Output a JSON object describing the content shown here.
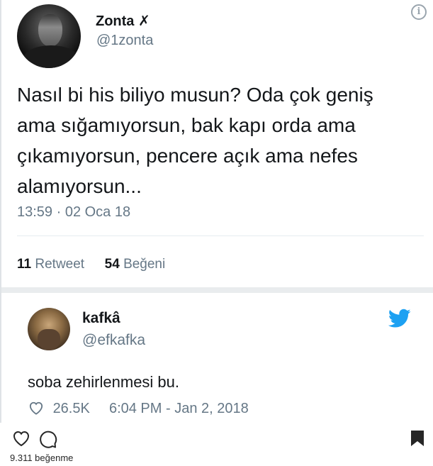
{
  "tweet1": {
    "display_name": "Zonta",
    "name_mark": "✗",
    "handle": "@1zonta",
    "text": "Nasıl bi his biliyo musun? Oda çok geniş ama sığamıyorsun, bak kapı orda ama çıkamıyorsun, pencere açık ama nefes alamıyorsun...",
    "timestamp": "13:59 · 02 Oca 18",
    "retweet_count": "11",
    "retweet_label": "Retweet",
    "like_count": "54",
    "like_label": "Beğeni",
    "info_icon": "info-icon"
  },
  "tweet2": {
    "display_name": "kafkâ",
    "handle": "@efkafka",
    "text": "soba zehirlenmesi bu.",
    "like_count": "26.5K",
    "timestamp": "6:04 PM - Jan 2, 2018",
    "icons": [
      "twitter-bird-icon",
      "heart-outline-icon"
    ]
  },
  "instagram": {
    "likes_text": "9.311 beğenme",
    "icons": [
      "heart-icon",
      "comment-icon",
      "bookmark-icon"
    ]
  },
  "colors": {
    "twitter_blue": "#1da1f2",
    "muted_text": "#657786",
    "primary_text": "#14171a"
  }
}
